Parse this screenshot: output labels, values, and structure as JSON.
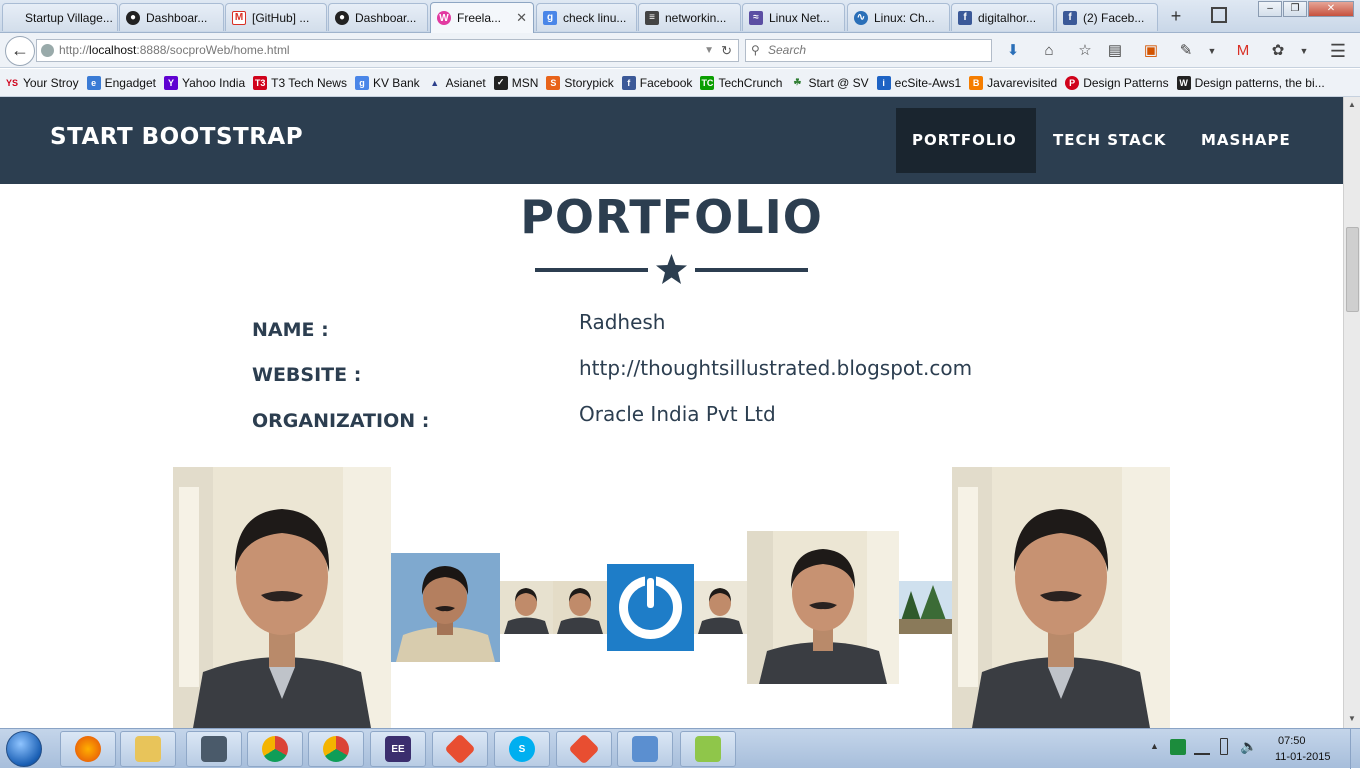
{
  "browser": {
    "tabs": [
      {
        "label": "Startup Village...",
        "icon": "none",
        "color": "#dfe8f3"
      },
      {
        "label": "Dashboar...",
        "icon": "github-octocat-icon",
        "color": "#222222"
      },
      {
        "label": "[GitHub] ...",
        "icon": "gmail-icon",
        "color": "#d93025"
      },
      {
        "label": "Dashboar...",
        "icon": "github-octocat-icon",
        "color": "#222222"
      },
      {
        "label": "Freela...",
        "icon": "freelancer-icon",
        "color": "#e23aa1"
      },
      {
        "label": "check linu...",
        "icon": "google-icon",
        "color": "#4a86e8"
      },
      {
        "label": "networkin...",
        "icon": "stack-icon",
        "color": "#444444"
      },
      {
        "label": "Linux Net...",
        "icon": "linux-icon",
        "color": "#5b4ea3"
      },
      {
        "label": "Linux: Ch...",
        "icon": "wave-icon",
        "color": "#2a6fb8"
      },
      {
        "label": "digitalhor...",
        "icon": "facebook-icon",
        "color": "#3b5998"
      },
      {
        "label": "(2) Faceb...",
        "icon": "facebook-icon",
        "color": "#3b5998"
      }
    ],
    "url": {
      "prefix": "http://",
      "host": "localhost",
      "rest": ":8888/socproWeb/home.html"
    },
    "search_placeholder": "Search",
    "bookmarks": [
      {
        "label": "Your Stroy",
        "icon": "ys-icon",
        "color": "#d0021b"
      },
      {
        "label": "Engadget",
        "icon": "engadget-icon",
        "color": "#3a7bd5"
      },
      {
        "label": "Yahoo India",
        "icon": "yahoo-icon",
        "color": "#5f01d1"
      },
      {
        "label": "T3 Tech News",
        "icon": "t3-icon",
        "color": "#d0021b"
      },
      {
        "label": "KV Bank",
        "icon": "google-icon",
        "color": "#4a86e8"
      },
      {
        "label": "Asianet",
        "icon": "asianet-icon",
        "color": "#2b3f8c"
      },
      {
        "label": "MSN",
        "icon": "msn-icon",
        "color": "#222222"
      },
      {
        "label": "Storypick",
        "icon": "storypick-icon",
        "color": "#e8631a"
      },
      {
        "label": "Facebook",
        "icon": "facebook-icon",
        "color": "#3b5998"
      },
      {
        "label": "TechCrunch",
        "icon": "techcrunch-icon",
        "color": "#0a9e01"
      },
      {
        "label": "Start @ SV",
        "icon": "sv-icon",
        "color": "#2e7d32"
      },
      {
        "label": "ecSite-Aws1",
        "icon": "info-icon",
        "color": "#1e63c4"
      },
      {
        "label": "Javarevisited",
        "icon": "blogger-icon",
        "color": "#f57d00"
      },
      {
        "label": "Design Patterns",
        "icon": "patterns-icon",
        "color": "#d0021b"
      },
      {
        "label": "Design patterns, the bi...",
        "icon": "wikipedia-icon",
        "color": "#222222"
      }
    ]
  },
  "site": {
    "brand": "START BOOTSTRAP",
    "nav": [
      "PORTFOLIO",
      "TECH STACK",
      "MASHAPE"
    ],
    "title": "PORTFOLIO",
    "profile": [
      {
        "label": "NAME :",
        "value": "Radhesh"
      },
      {
        "label": "WEBSITE :",
        "value": "http://thoughtsillustrated.blogspot.com"
      },
      {
        "label": "ORGANIZATION :",
        "value": "Oracle India Pvt Ltd"
      }
    ],
    "photos": [
      {
        "subject": "profile-photo-large"
      },
      {
        "subject": "profile-photo-beige-shirt"
      },
      {
        "subject": "profile-photo-small"
      },
      {
        "subject": "profile-photo-small"
      },
      {
        "subject": "power-logo"
      },
      {
        "subject": "profile-photo-small"
      },
      {
        "subject": "profile-photo-medium"
      },
      {
        "subject": "landscape-trees"
      },
      {
        "subject": "profile-photo-large"
      }
    ],
    "colors": {
      "primary": "#2c3e50",
      "active_nav": "#1a252f"
    }
  },
  "taskbar": {
    "apps": [
      "Firefox",
      "Windows Explorer",
      "Network Monitor",
      "Chrome",
      "Chrome",
      "Java EE IDE",
      "Git",
      "Skype",
      "Git",
      "Control Panel",
      "Notepad++"
    ],
    "time": "07:50",
    "date": "11-01-2015"
  }
}
